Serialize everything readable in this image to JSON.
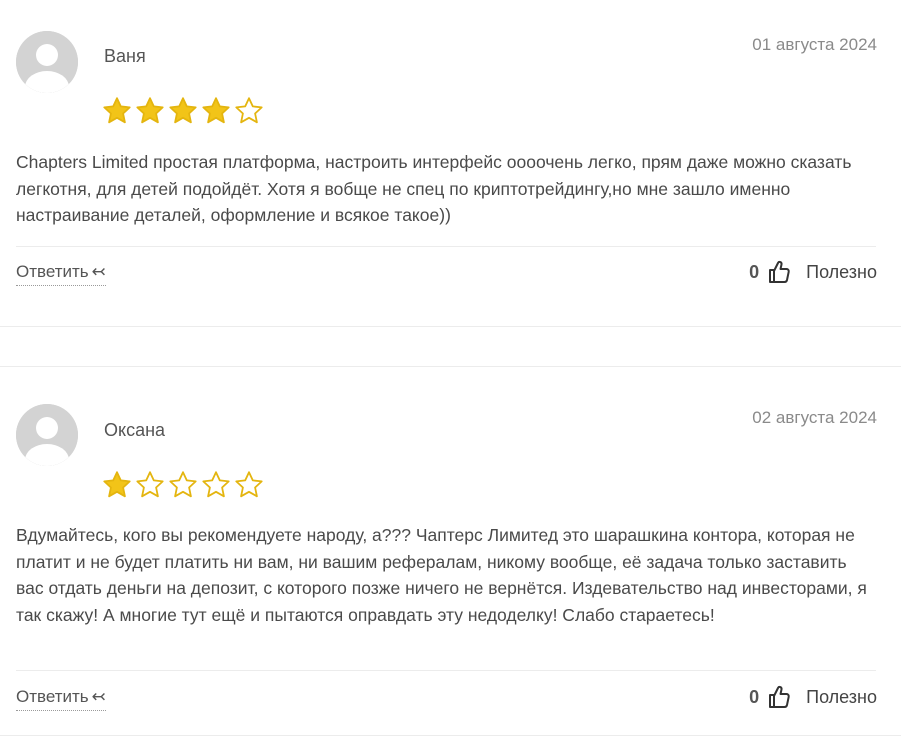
{
  "reviews": [
    {
      "author": "Ваня",
      "date": "01 августа 2024",
      "rating": 4,
      "rating_max": 5,
      "text": "Chapters Limited простая платформа, настроить интерфейс оооочень легко, прям даже можно сказать легкотня, для детей подойдёт. Хотя я вобще не спец по криптотрейдингу,но мне зашло именно настраивание деталей, оформление и всякое такое))",
      "reply_label": "Ответить",
      "reply_icon": "reply-arrow-icon",
      "helpful_count": "0",
      "helpful_icon": "thumbs-up-icon",
      "helpful_label": "Полезно"
    },
    {
      "author": "Оксана",
      "date": "02 августа 2024",
      "rating": 1,
      "rating_max": 5,
      "text": "Вдумайтесь, кого вы рекомендуете народу, а??? Чаптерс Лимитед это шарашкина контора, которая не платит и не будет платить ни вам, ни вашим рефералам, никому вообще, её задача только заставить вас отдать деньги на депозит, с которого позже ничего не вернётся. Издевательство над инвесторами, я так скажу! А многие тут ещё и пытаются оправдать эту недоделку! Слабо стараетесь!",
      "reply_label": "Ответить",
      "reply_icon": "reply-arrow-icon",
      "helpful_count": "0",
      "helpful_icon": "thumbs-up-icon",
      "helpful_label": "Полезно"
    }
  ],
  "colors": {
    "star_fill": "#f2c418",
    "star_outline": "#e4b50f",
    "avatar_bg": "#d3d3d3",
    "avatar_fg": "#ffffff",
    "divider": "#ececec"
  }
}
